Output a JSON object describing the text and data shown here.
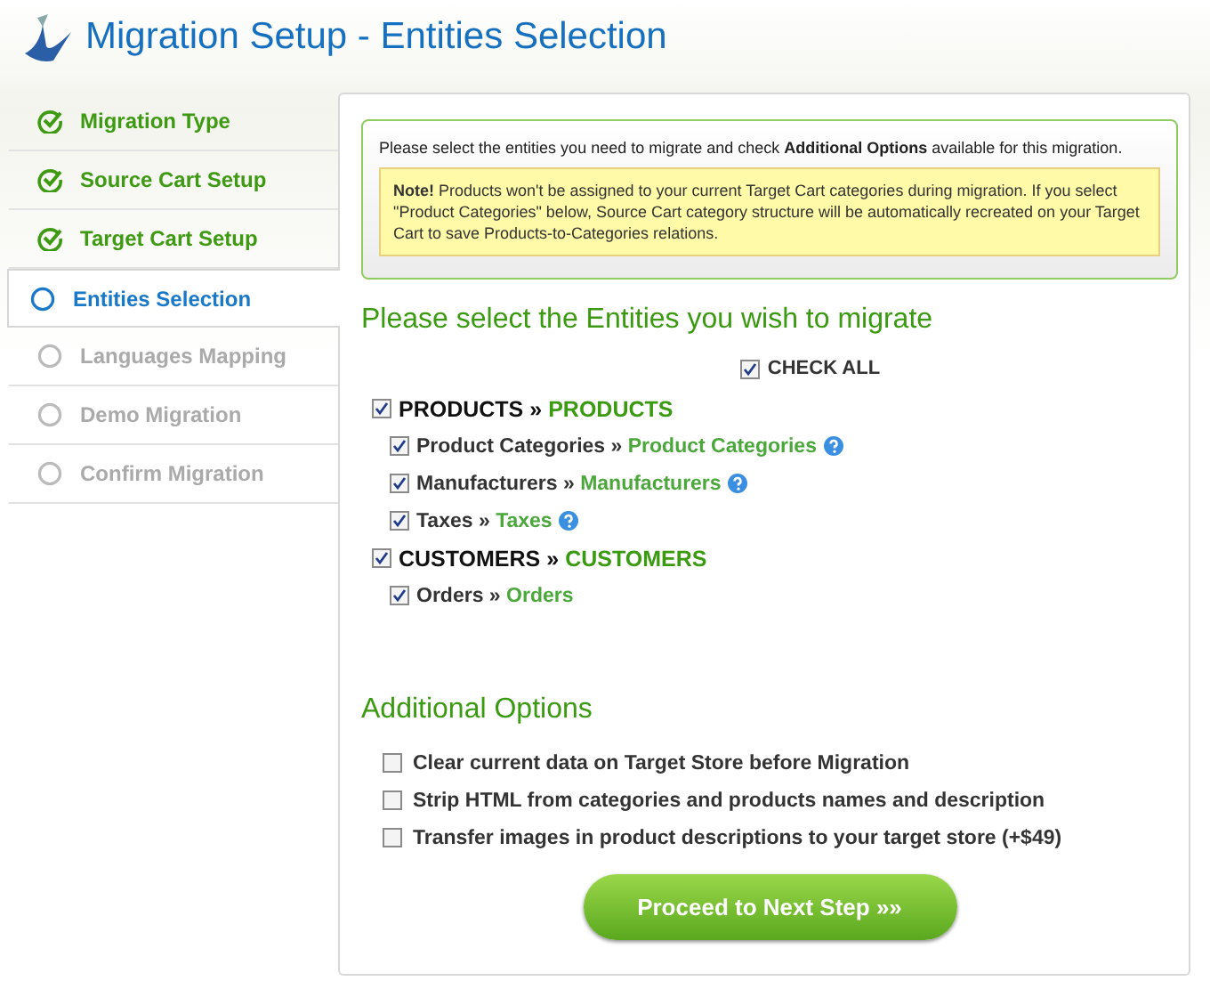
{
  "header": {
    "title": "Migration Setup - Entities Selection"
  },
  "steps": [
    {
      "label": "Migration Type",
      "kind": "done",
      "selected": false
    },
    {
      "label": "Source Cart Setup",
      "kind": "done",
      "selected": false
    },
    {
      "label": "Target Cart Setup",
      "kind": "done",
      "selected": false
    },
    {
      "label": "Entities Selection",
      "kind": "current",
      "selected": true
    },
    {
      "label": "Languages Mapping",
      "kind": "pending",
      "selected": false
    },
    {
      "label": "Demo Migration",
      "kind": "pending",
      "selected": false
    },
    {
      "label": "Confirm Migration",
      "kind": "pending",
      "selected": false
    }
  ],
  "info": {
    "text": "Please select the entities you need to migrate and check **Additional Options** available for this migration.",
    "note": "**Note!** Products won't be assigned to your current Target Cart categories during migration. If you select \"Product Categories\" below, Source Cart category structure will be automatically recreated on your Target Cart to save Products-to-Categories relations."
  },
  "entities_heading": "Please select the Entities you wish to migrate",
  "check_all": {
    "label": "CHECK ALL",
    "checked": true
  },
  "entities": [
    {
      "source": "PRODUCTS",
      "separator": "»",
      "target": "PRODUCTS",
      "checked": true,
      "children": [
        {
          "source": "Product Categories",
          "separator": "»",
          "target": "Product Categories",
          "checked": true,
          "help": true
        },
        {
          "source": "Manufacturers",
          "separator": "»",
          "target": "Manufacturers",
          "checked": true,
          "help": true
        },
        {
          "source": "Taxes",
          "separator": "»",
          "target": "Taxes",
          "checked": true,
          "help": true
        }
      ]
    },
    {
      "source": "CUSTOMERS",
      "separator": "»",
      "target": "CUSTOMERS",
      "checked": true,
      "children": [
        {
          "source": "Orders",
          "separator": "»",
          "target": "Orders",
          "checked": true,
          "help": false
        }
      ]
    }
  ],
  "options_heading": "Additional Options",
  "options": [
    {
      "label": "Clear current data on Target Store before Migration",
      "checked": false
    },
    {
      "label": "Strip HTML from categories and products names and description",
      "checked": false
    },
    {
      "label": "Transfer images in product descriptions to your target store (+$49)",
      "checked": false
    }
  ],
  "proceed_button": "Proceed to Next Step »»"
}
